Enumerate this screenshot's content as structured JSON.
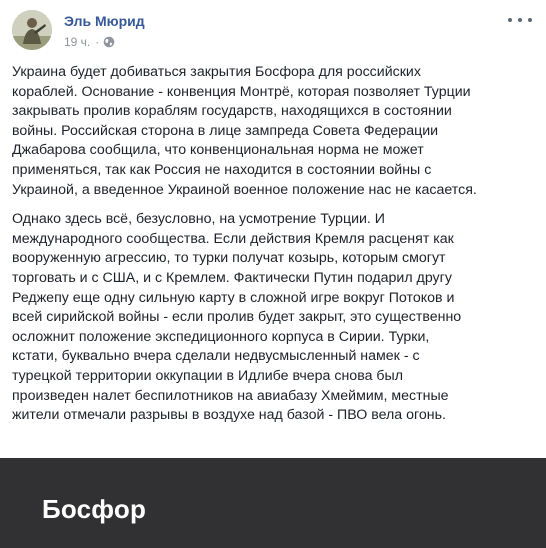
{
  "post": {
    "author": "Эль Мюрид",
    "timestamp": "19 ч.",
    "separator": "·",
    "privacy_icon": "globe-icon",
    "more_icon": "more-options-icon",
    "paragraphs": [
      "Украина будет добиваться закрытия Босфора для российских\nкораблей. Основание - конвенция Монтрё, которая позволяет Турции\nзакрывать пролив кораблям государств, находящихся в состоянии\nвойны. Российская сторона в лице зампреда Совета Федерации\nДжабарова сообщила, что конвенциональная норма не может\nприменяться, так как Россия не находится в состоянии войны с\nУкраиной, а введенное Украиной военное положение нас не касается.",
      "Однако здесь всё, безусловно, на усмотрение Турции. И\nмеждународного сообщества. Если действия Кремля расценят как\nвооруженную агрессию, то турки получат козырь, которым смогут\nторговать и с США, и с Кремлем. Фактически Путин подарил другу\nРеджепу еще одну сильную карту в сложной игре вокруг Потоков и\nвсей сирийской войны - если пролив будет закрыт, это существенно\nосложнит положение экспедиционного корпуса в Сирии. Турки,\nкстати, буквально вчера сделали недвусмысленный намек - с\nтурецкой территории оккупации в Идлибе вчера снова был\nпроизведен налет беспилотников на авиабазу Хмеймим, местные\nжители отмечали разрывы в воздухе над базой - ПВО вела огонь."
    ]
  },
  "link_preview": {
    "title": "Босфор"
  },
  "colors": {
    "author": "#365899",
    "meta": "#90949c",
    "text": "#1d2129",
    "card_background": "#313133"
  }
}
